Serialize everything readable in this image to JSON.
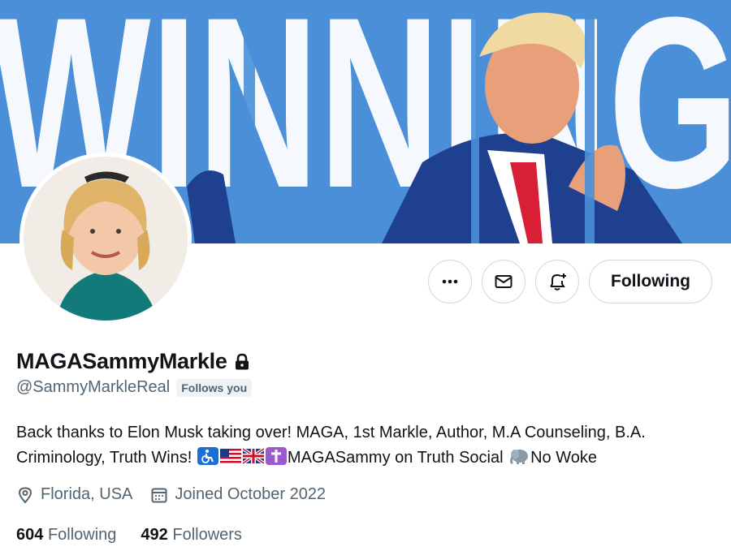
{
  "banner": {
    "text": "WINNING"
  },
  "actions": {
    "more_icon": "more-dots-icon",
    "message_icon": "envelope-icon",
    "notify_icon": "bell-plus-icon",
    "follow_label": "Following"
  },
  "profile": {
    "display_name": "MAGASammyMarkle",
    "protected_icon": "lock-icon",
    "handle": "@SammyMarkleReal",
    "follows_you": "Follows you",
    "bio": {
      "text_1": "Back thanks to Elon Musk taking over! MAGA, 1st Markle, Author, M.A Counseling, B.A. Criminology, Truth Wins! ",
      "emojis_1": [
        "wheelchair-emoji",
        "us-flag-emoji",
        "uk-flag-emoji",
        "cross-emoji"
      ],
      "text_2": "MAGASammy on Truth Social ",
      "emojis_2": [
        "elephant-emoji"
      ],
      "text_3": "No Woke"
    },
    "location_icon": "location-pin-icon",
    "location": "Florida, USA",
    "calendar_icon": "calendar-icon",
    "joined": "Joined October 2022",
    "following_count": "604",
    "following_label": "Following",
    "followers_count": "492",
    "followers_label": "Followers"
  },
  "colors": {
    "banner_blue": "#4a8fd8",
    "text_primary": "#0f1419",
    "text_secondary": "#536471",
    "border": "#cfd9de"
  }
}
